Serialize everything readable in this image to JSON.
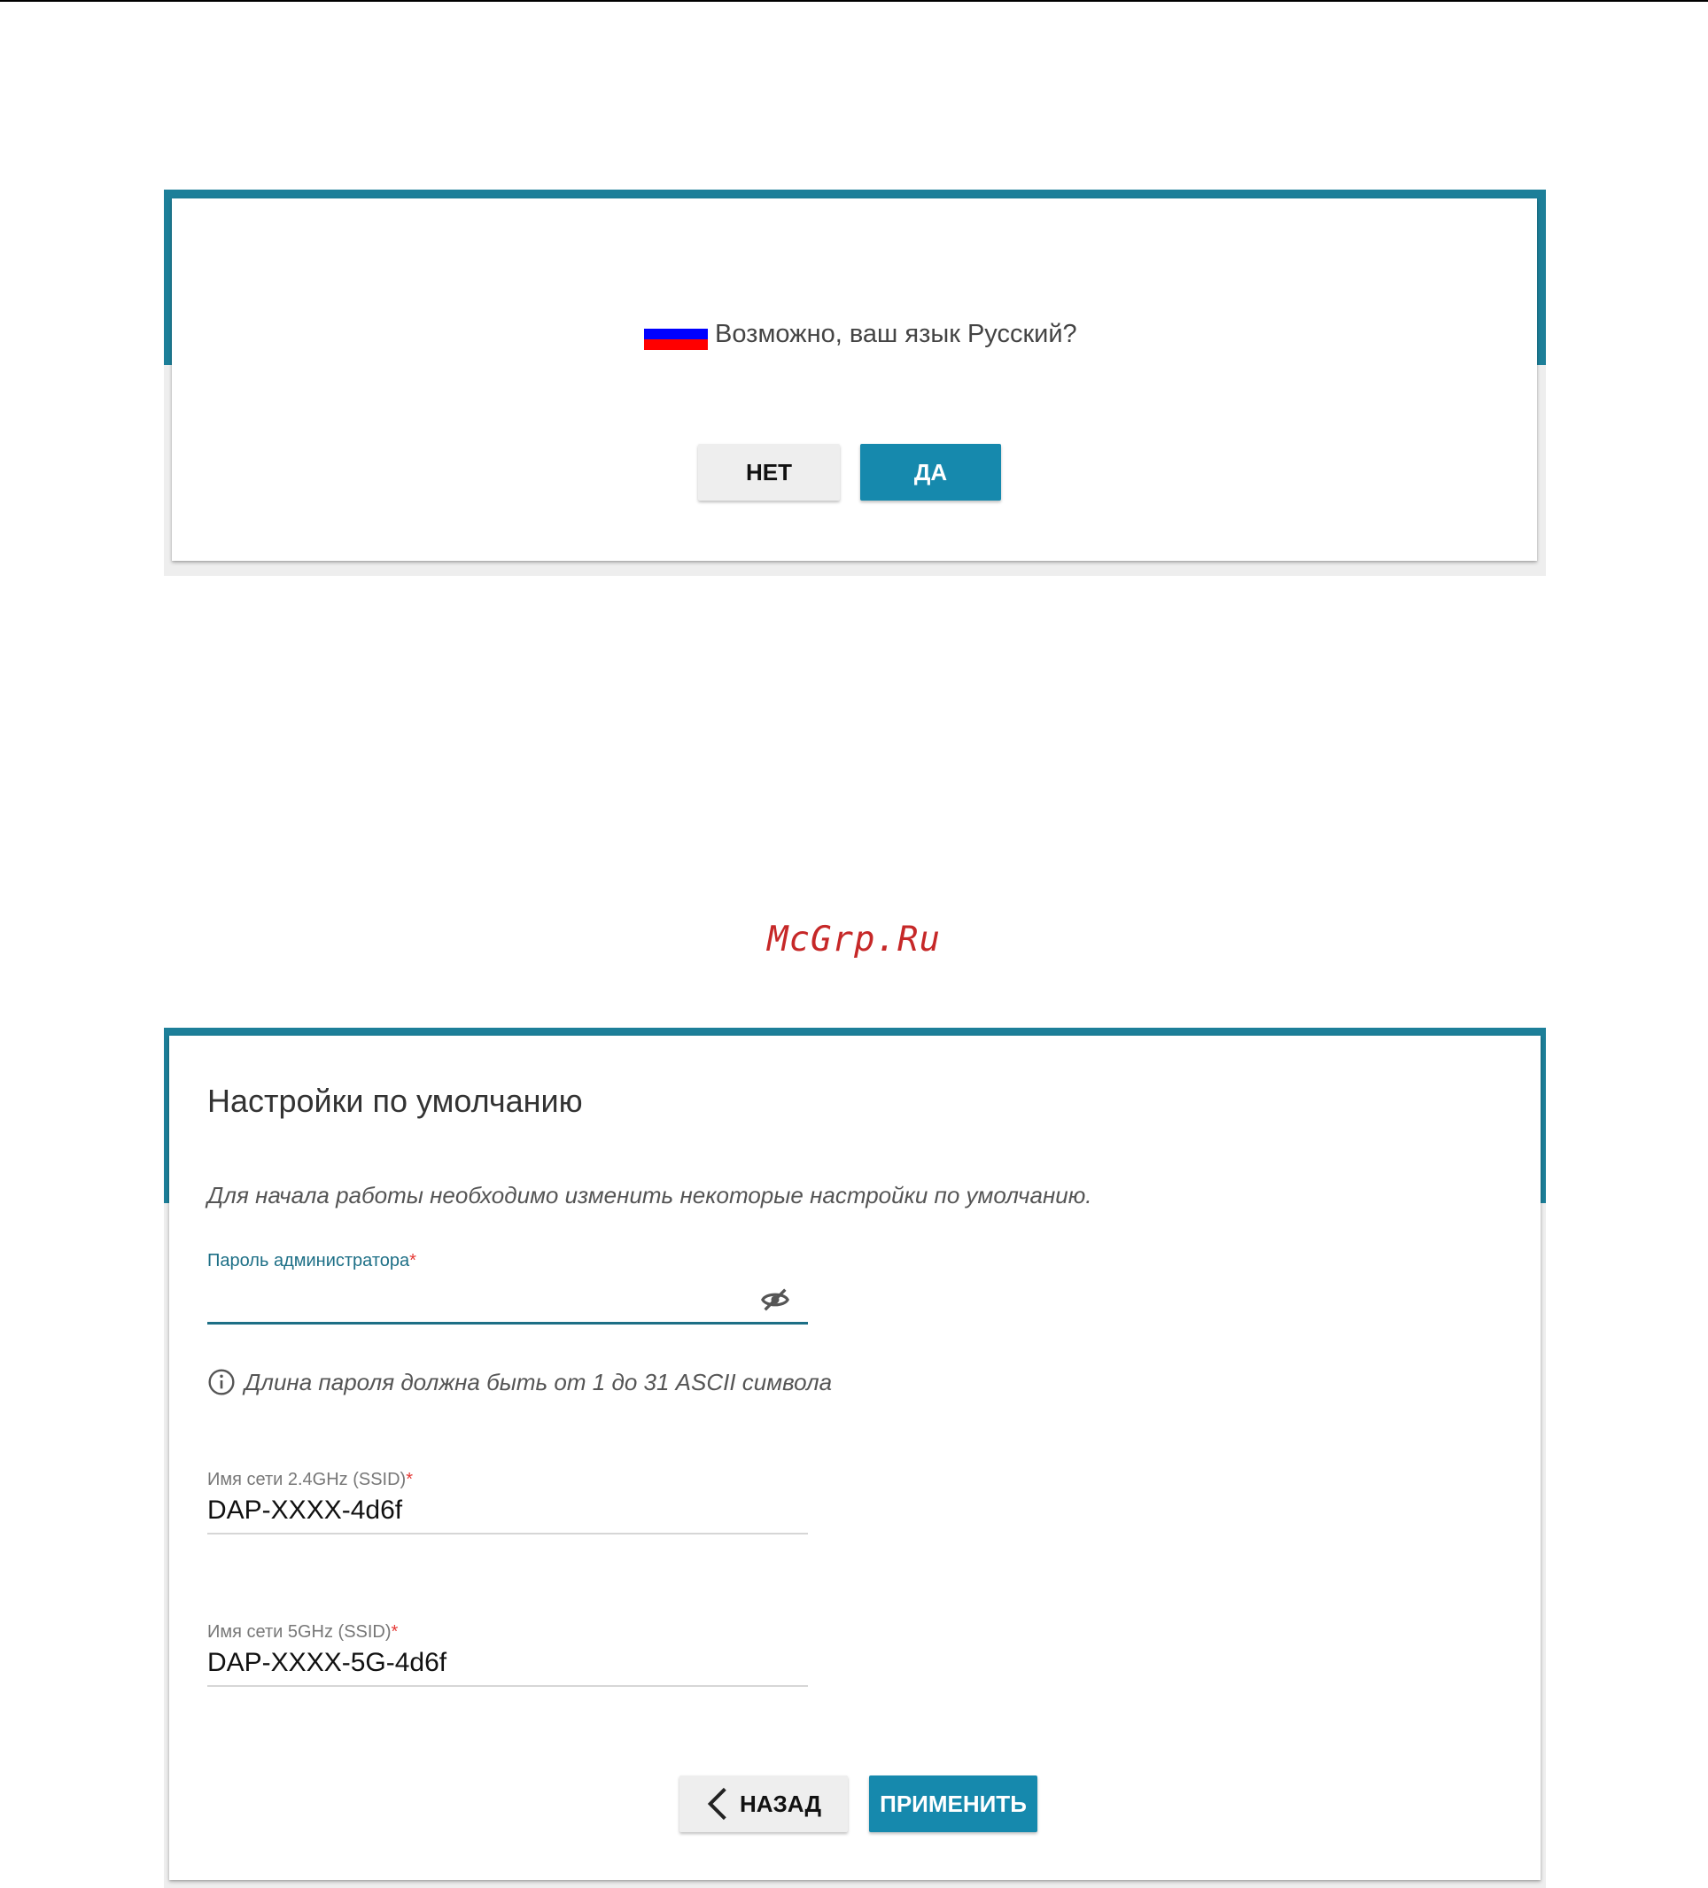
{
  "language_dialog": {
    "question": "Возможно, ваш язык Русский?",
    "flag_colors": [
      "#ffffff",
      "#0000ff",
      "#ff0000"
    ],
    "no_label": "НЕТ",
    "yes_label": "ДА"
  },
  "watermark": "McGrp.Ru",
  "defaults_dialog": {
    "title": "Настройки по умолчанию",
    "intro": "Для начала работы необходимо изменить некоторые настройки по умолчанию.",
    "admin_password": {
      "label": "Пароль администратора",
      "required_mark": "*",
      "value": "",
      "hint": "Длина пароля должна быть от 1 до 31 ASCII символа"
    },
    "ssid_24": {
      "label": "Имя сети 2.4GHz (SSID)",
      "required_mark": "*",
      "value": "DAP-XXXX-4d6f"
    },
    "ssid_5": {
      "label": "Имя сети 5GHz (SSID)",
      "required_mark": "*",
      "value": "DAP-XXXX-5G-4d6f"
    },
    "back_label": "НАЗАД",
    "apply_label": "ПРИМЕНИТЬ"
  },
  "colors": {
    "accent": "#1689ad",
    "band": "#1d7f99",
    "required": "#e53935"
  },
  "icons": [
    "eye-off-icon",
    "info-icon",
    "chevron-left-icon",
    "russian-flag-icon"
  ]
}
